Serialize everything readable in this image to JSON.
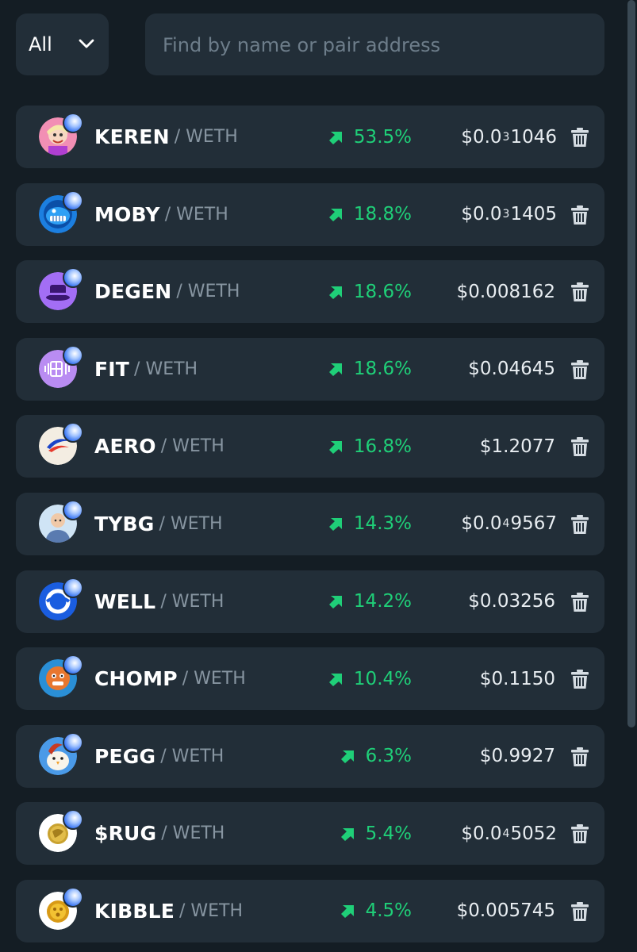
{
  "filter": {
    "label": "All"
  },
  "search": {
    "placeholder": "Find by name or pair address"
  },
  "colors": {
    "background": "#141d24",
    "card": "#222e38",
    "positive": "#1fcf78",
    "muted": "#8795a1"
  },
  "pairs": [
    {
      "symbol": "KEREN",
      "quote": "/ WETH",
      "change": "53.5%",
      "price_prefix": "$0.0",
      "price_zeros": "3",
      "price_digits": "1046",
      "icon": "keren-token-icon"
    },
    {
      "symbol": "MOBY",
      "quote": "/ WETH",
      "change": "18.8%",
      "price_prefix": "$0.0",
      "price_zeros": "3",
      "price_digits": "1405",
      "icon": "moby-token-icon"
    },
    {
      "symbol": "DEGEN",
      "quote": "/ WETH",
      "change": "18.6%",
      "price_prefix": "$0.008162",
      "price_zeros": "",
      "price_digits": "",
      "icon": "degen-token-icon"
    },
    {
      "symbol": "FIT",
      "quote": "/ WETH",
      "change": "18.6%",
      "price_prefix": "$0.04645",
      "price_zeros": "",
      "price_digits": "",
      "icon": "fit-token-icon"
    },
    {
      "symbol": "AERO",
      "quote": "/ WETH",
      "change": "16.8%",
      "price_prefix": "$1.2077",
      "price_zeros": "",
      "price_digits": "",
      "icon": "aero-token-icon"
    },
    {
      "symbol": "TYBG",
      "quote": "/ WETH",
      "change": "14.3%",
      "price_prefix": "$0.0",
      "price_zeros": "4",
      "price_digits": "9567",
      "icon": "tybg-token-icon"
    },
    {
      "symbol": "WELL",
      "quote": "/ WETH",
      "change": "14.2%",
      "price_prefix": "$0.03256",
      "price_zeros": "",
      "price_digits": "",
      "icon": "well-token-icon"
    },
    {
      "symbol": "CHOMP",
      "quote": "/ WETH",
      "change": "10.4%",
      "price_prefix": "$0.1150",
      "price_zeros": "",
      "price_digits": "",
      "icon": "chomp-token-icon"
    },
    {
      "symbol": "PEGG",
      "quote": "/ WETH",
      "change": "6.3%",
      "price_prefix": "$0.9927",
      "price_zeros": "",
      "price_digits": "",
      "icon": "pegg-token-icon"
    },
    {
      "symbol": "$RUG",
      "quote": "/ WETH",
      "change": "5.4%",
      "price_prefix": "$0.0",
      "price_zeros": "4",
      "price_digits": "5052",
      "icon": "rug-token-icon"
    },
    {
      "symbol": "KIBBLE",
      "quote": "/ WETH",
      "change": "4.5%",
      "price_prefix": "$0.005745",
      "price_zeros": "",
      "price_digits": "",
      "icon": "kibble-token-icon"
    }
  ]
}
